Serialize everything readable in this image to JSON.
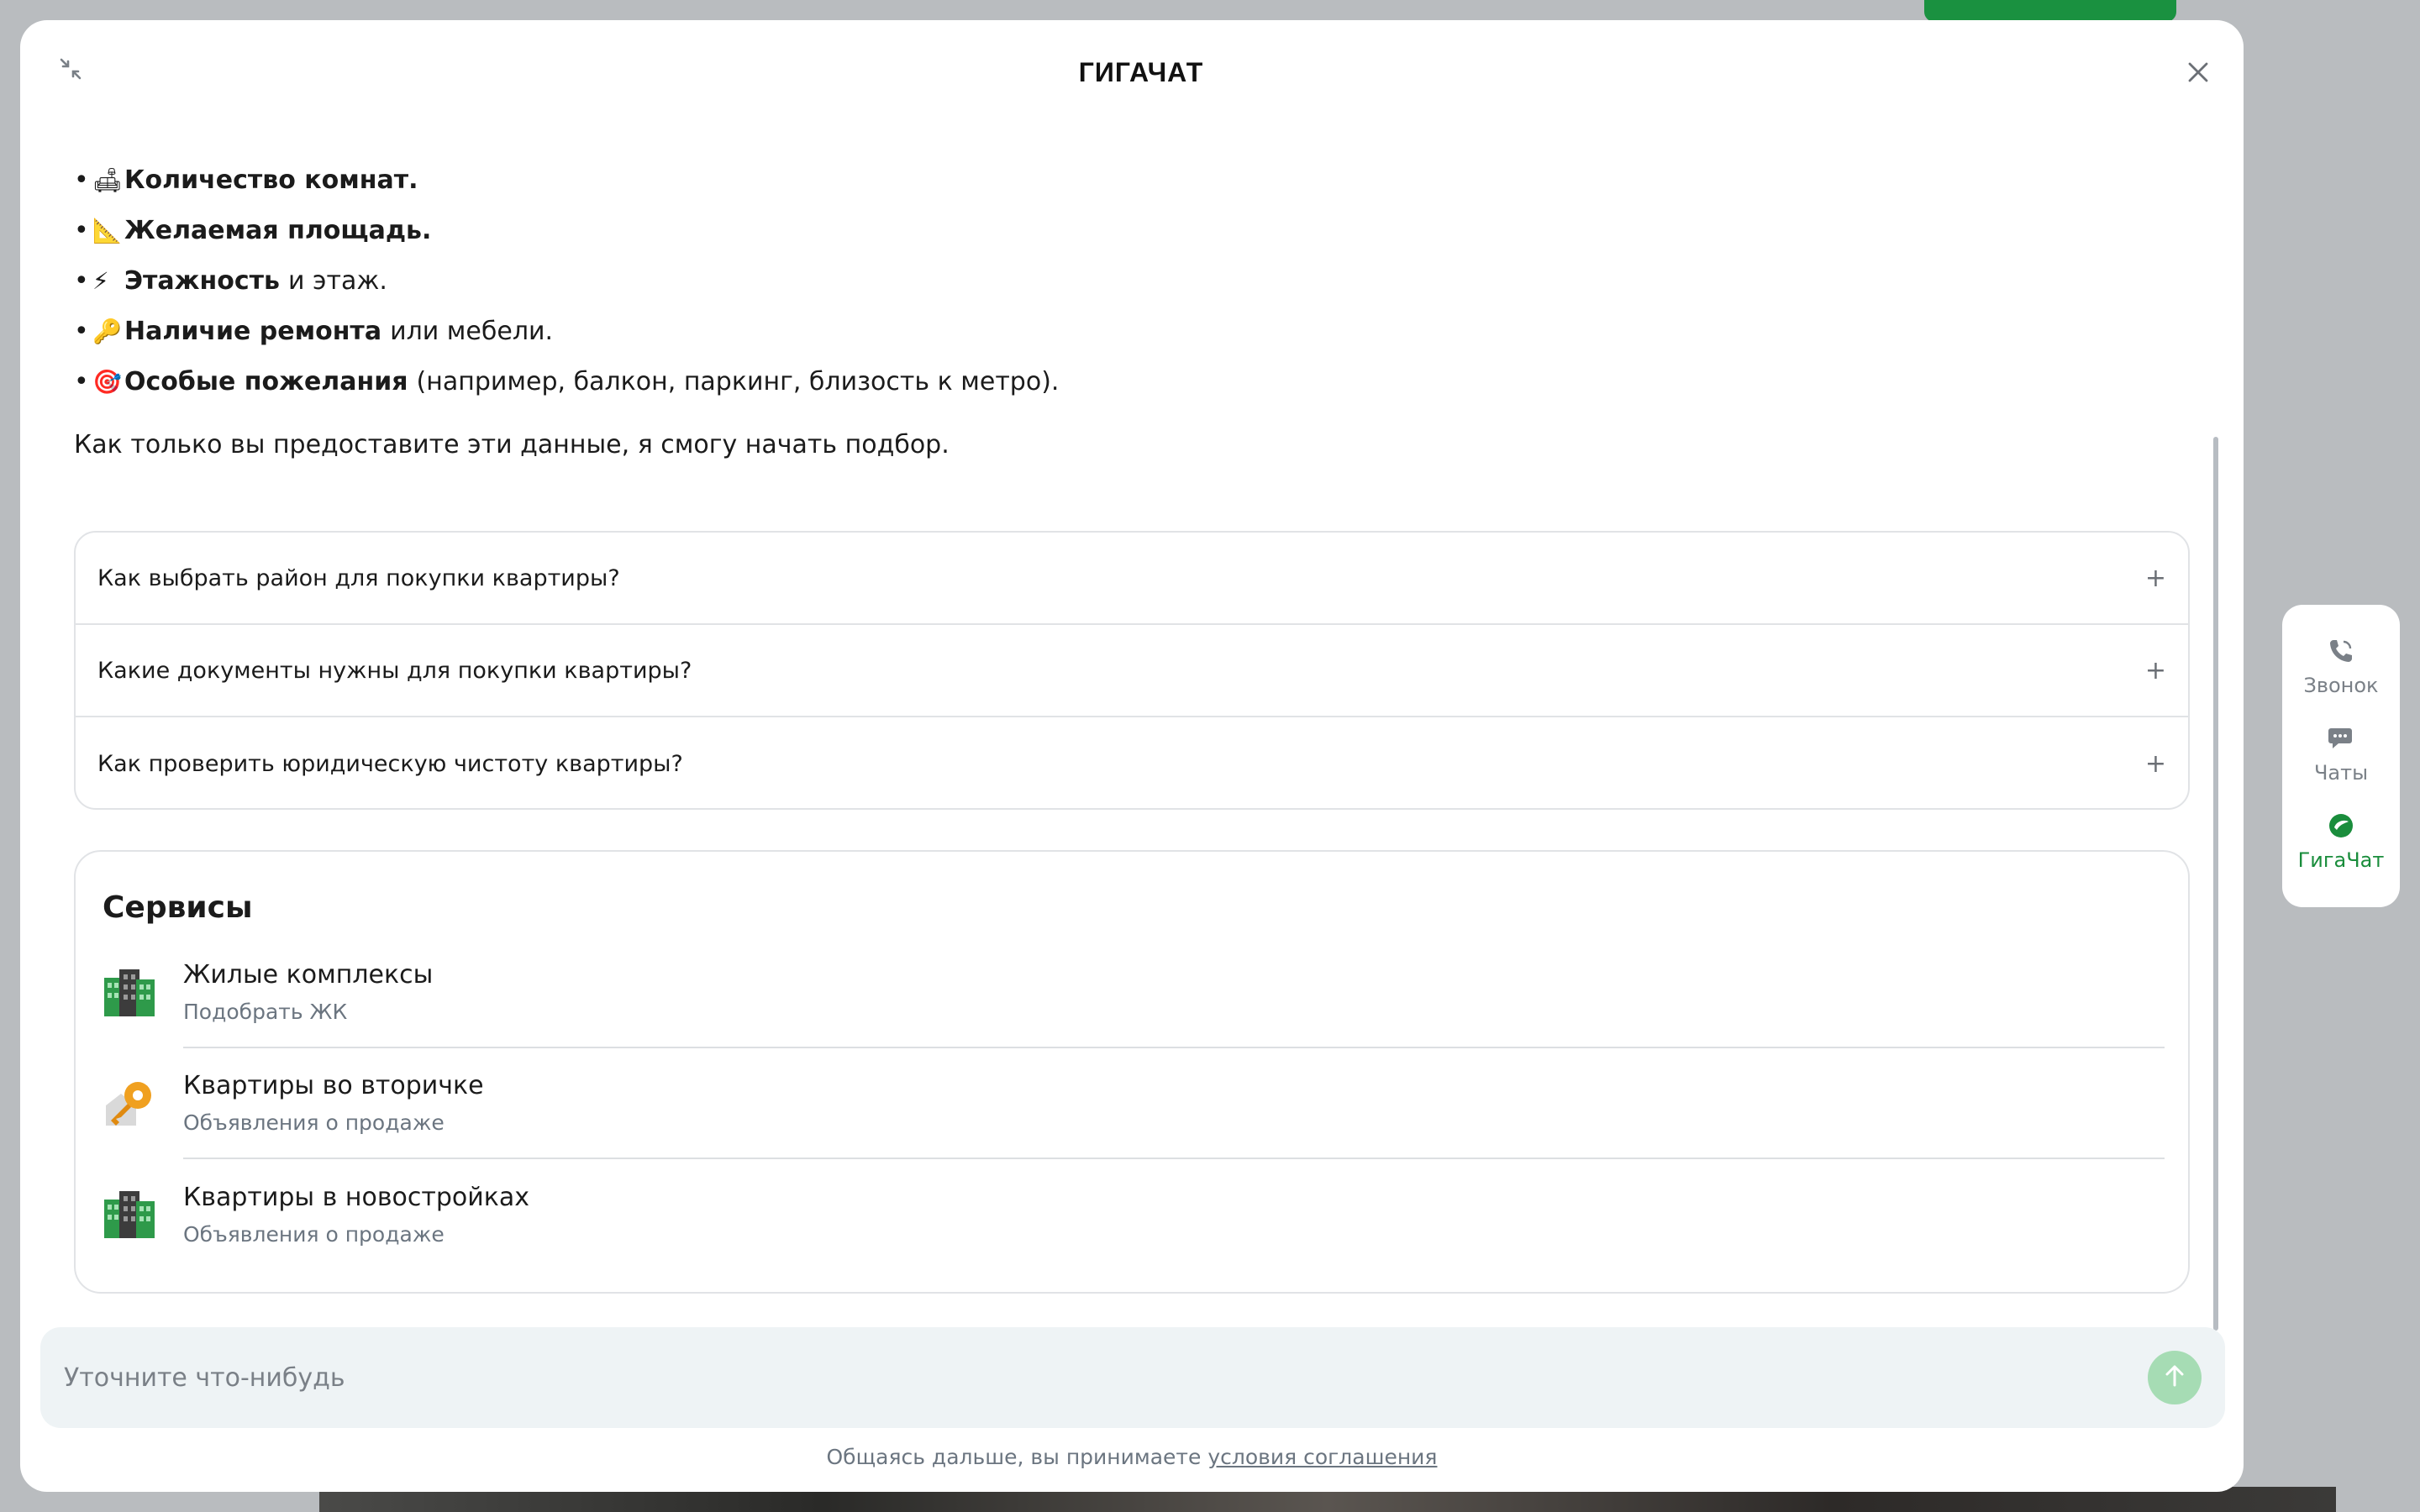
{
  "header": {
    "logo_text": "ГИГАЧАТ"
  },
  "message": {
    "bullets": [
      {
        "icon": "car-seat-icon",
        "emoji": "🛋",
        "bold": "Количество комнат.",
        "rest": ""
      },
      {
        "icon": "ruler-icon",
        "emoji": "📐",
        "bold": "Желаемая площадь.",
        "rest": ""
      },
      {
        "icon": "lightning-icon",
        "emoji": "⚡",
        "bold": "Этажность",
        "rest": "и этаж."
      },
      {
        "icon": "key-icon",
        "emoji": "🔑",
        "bold": "Наличие ремонта",
        "rest": "или мебели."
      },
      {
        "icon": "target-icon",
        "emoji": "🎯",
        "bold": "Особые пожелания",
        "rest": "(например, балкон, паркинг, близость к метро)."
      }
    ],
    "closing": "Как только вы предоставите эти данные, я смогу начать подбор."
  },
  "suggestions": [
    {
      "question": "Как выбрать район для покупки квартиры?",
      "toggle": "+"
    },
    {
      "question": "Какие документы нужны для покупки квартиры?",
      "toggle": "+"
    },
    {
      "question": "Как проверить юридическую чистоту квартиры?",
      "toggle": "+"
    }
  ],
  "services": {
    "title": "Сервисы",
    "items": [
      {
        "icon": "buildings-icon",
        "title": "Жилые комплексы",
        "subtitle": "Подобрать ЖК"
      },
      {
        "icon": "key-house-icon",
        "title": "Квартиры во вторичке",
        "subtitle": "Объявления о продаже"
      },
      {
        "icon": "buildings-icon",
        "title": "Квартиры в новостройках",
        "subtitle": "Объявления о продаже"
      }
    ]
  },
  "input": {
    "placeholder": "Уточните что-нибудь",
    "value": ""
  },
  "footer": {
    "text": "Общаясь дальше, вы принимаете",
    "link": "условия соглашения"
  },
  "side_panel": {
    "items": [
      {
        "icon": "phone-icon",
        "label": "Звонок",
        "active": false
      },
      {
        "icon": "chat-icon",
        "label": "Чаты",
        "active": false
      },
      {
        "icon": "gigachat-icon",
        "label": "ГигаЧат",
        "active": true
      }
    ]
  },
  "colors": {
    "accent": "#1a8d3c",
    "send_button": "#a6dcb4",
    "input_bg": "#eef3f5"
  }
}
